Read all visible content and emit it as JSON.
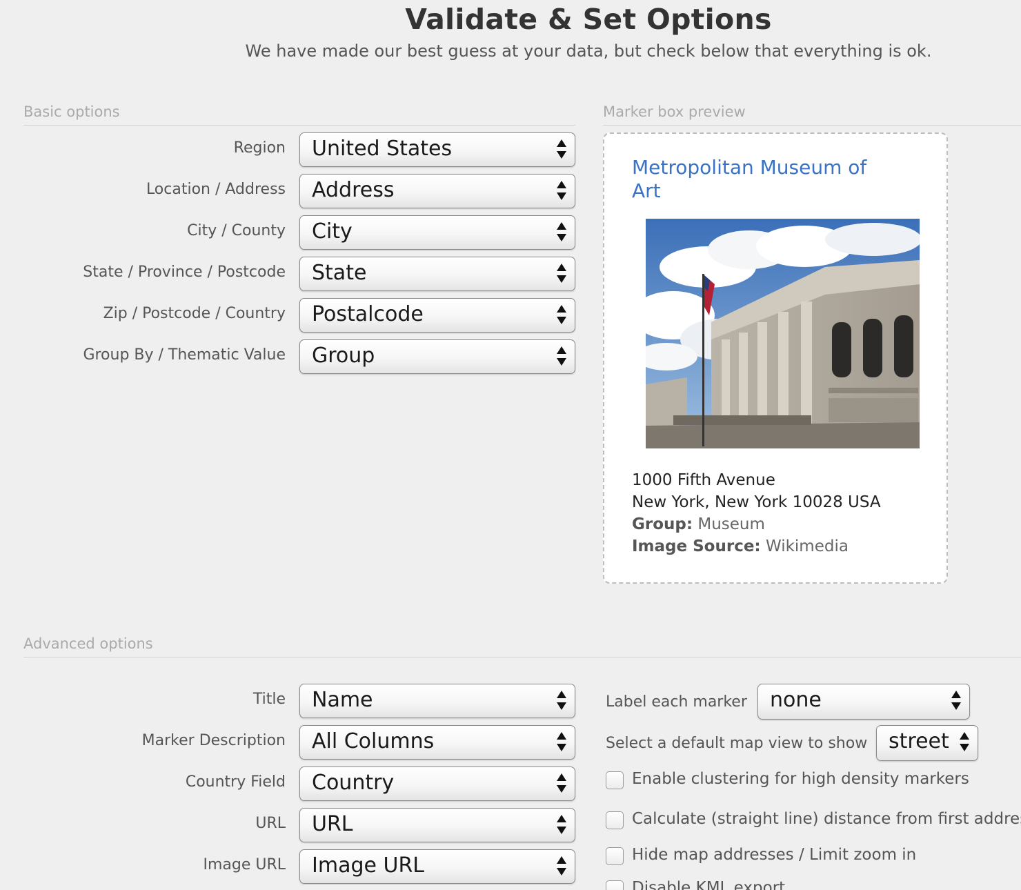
{
  "header": {
    "title": "Validate & Set Options",
    "subtitle": "We have made our best guess at your data, but check below that everything is ok."
  },
  "basic": {
    "heading": "Basic options",
    "fields": [
      {
        "label": "Region",
        "value": "United States"
      },
      {
        "label": "Location / Address",
        "value": "Address"
      },
      {
        "label": "City / County",
        "value": "City"
      },
      {
        "label": "State / Province / Postcode",
        "value": "State"
      },
      {
        "label": "Zip / Postcode / Country",
        "value": "Postalcode"
      },
      {
        "label": "Group By / Thematic Value",
        "value": "Group"
      }
    ]
  },
  "preview": {
    "heading": "Marker box preview",
    "title": "Metropolitan Museum of Art",
    "address_line1": "1000 Fifth Avenue",
    "address_line2": "New York, New York 10028 USA",
    "group_label": "Group:",
    "group_value": "Museum",
    "image_source_label": "Image Source:",
    "image_source_value": "Wikimedia"
  },
  "advanced": {
    "heading": "Advanced options",
    "fields": [
      {
        "label": "Title",
        "value": "Name"
      },
      {
        "label": "Marker Description",
        "value": "All Columns"
      },
      {
        "label": "Country Field",
        "value": "Country"
      },
      {
        "label": "URL",
        "value": "URL"
      },
      {
        "label": "Image URL",
        "value": "Image URL"
      }
    ],
    "label_each_marker": {
      "label": "Label each marker",
      "value": "none"
    },
    "default_map_view": {
      "label": "Select a default map view to show",
      "value": "street"
    },
    "checkboxes": [
      {
        "label": "Enable clustering for high density markers",
        "checked": false
      },
      {
        "label": "Calculate (straight line) distance from first address",
        "checked": false
      },
      {
        "label": "Hide map addresses / Limit zoom in",
        "checked": false
      },
      {
        "label": "Disable KML export",
        "checked": false
      }
    ]
  },
  "colors": {
    "background": "#efefef",
    "link_title": "#3a72c4",
    "section_header": "#aaaaaa"
  }
}
